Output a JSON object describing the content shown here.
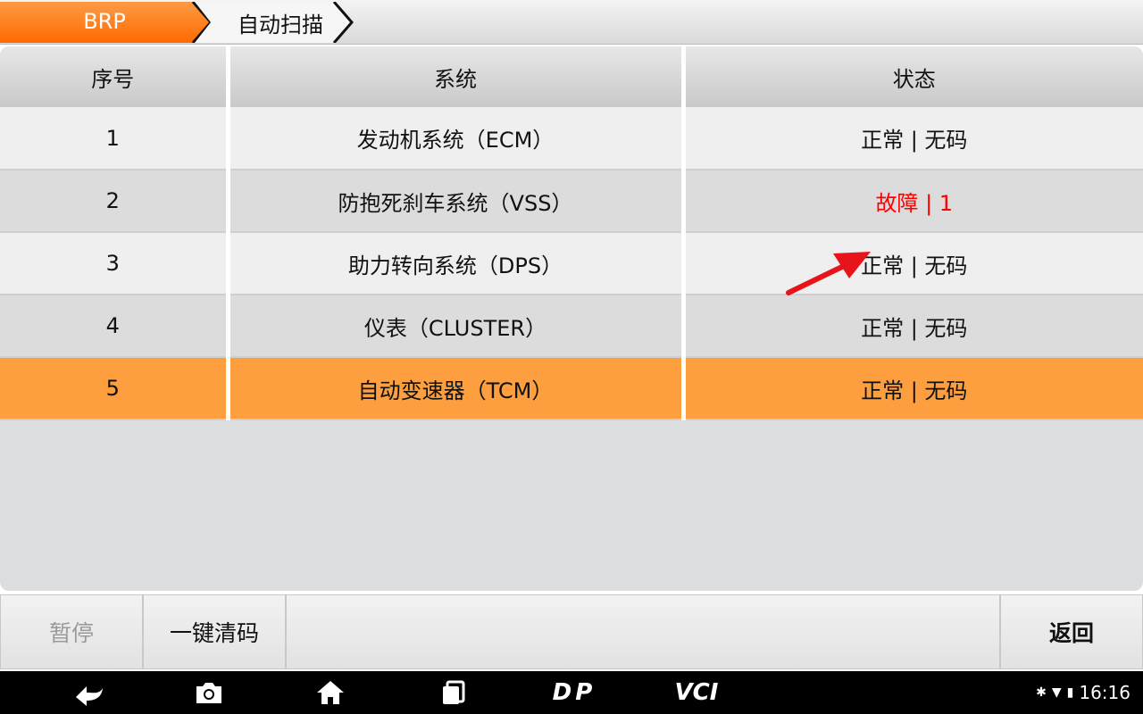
{
  "breadcrumb": {
    "home": "BRP",
    "current": "自动扫描"
  },
  "table": {
    "headers": [
      "序号",
      "系统",
      "状态"
    ],
    "rows": [
      {
        "index": "1",
        "system": "发动机系统（ECM）",
        "status": "正常 | 无码"
      },
      {
        "index": "2",
        "system": "防抱死刹车系统（VSS）",
        "status": "故障 | 1"
      },
      {
        "index": "3",
        "system": "助力转向系统（DPS）",
        "status": "正常 | 无码"
      },
      {
        "index": "4",
        "system": "仪表（CLUSTER）",
        "status": "正常 | 无码"
      },
      {
        "index": "5",
        "system": "自动变速器（TCM）",
        "status": "正常 | 无码"
      }
    ]
  },
  "toolbar": {
    "pause": "暂停",
    "clear_codes": "一键清码",
    "back": "返回"
  },
  "navbar": {
    "logo_dp": "DP",
    "logo_vci": "VCI",
    "time": "16:16"
  },
  "colors": {
    "accent": "#ff7f1e",
    "selected_row": "#fd9f3f",
    "fault": "#ff0000"
  }
}
